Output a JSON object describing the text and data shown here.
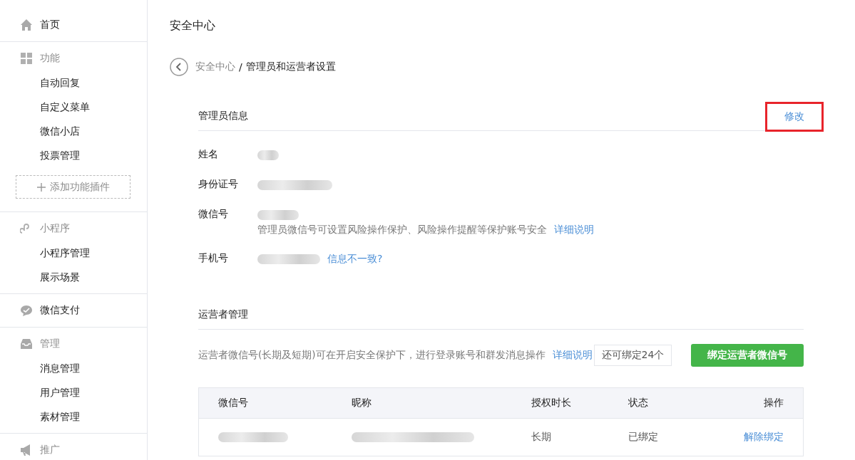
{
  "sidebar": {
    "sections": [
      {
        "kind": "link",
        "label": "首页"
      },
      {
        "kind": "group",
        "label": "功能",
        "items": [
          "自动回复",
          "自定义菜单",
          "微信小店",
          "投票管理"
        ],
        "add_button": "添加功能插件"
      },
      {
        "kind": "group",
        "label": "小程序",
        "items": [
          "小程序管理",
          "展示场景"
        ]
      },
      {
        "kind": "link",
        "label": "微信支付"
      },
      {
        "kind": "group",
        "label": "管理",
        "items": [
          "消息管理",
          "用户管理",
          "素材管理"
        ]
      },
      {
        "kind": "group",
        "label": "推广"
      }
    ]
  },
  "page": {
    "title": "安全中心",
    "breadcrumb": {
      "parent": "安全中心",
      "separator": "/",
      "current": "管理员和运营者设置"
    }
  },
  "admin": {
    "title": "管理员信息",
    "edit_link": "修改",
    "edit_highlighted": true,
    "fields": [
      {
        "label": "姓名"
      },
      {
        "label": "身份证号"
      },
      {
        "label": "微信号",
        "note": "管理员微信号可设置风险操作保护、风险操作提醒等保护账号安全",
        "note_link": "详细说明"
      },
      {
        "label": "手机号",
        "link": "信息不一致?"
      }
    ]
  },
  "operators": {
    "title": "运营者管理",
    "description": "运营者微信号(长期及短期)可在开启安全保护下，进行登录账号和群发消息操作",
    "description_link": "详细说明",
    "remaining": "还可绑定24个",
    "bind_button": "绑定运营者微信号",
    "table": {
      "columns": [
        "微信号",
        "昵称",
        "授权时长",
        "状态",
        "操作"
      ],
      "rows": [
        {
          "duration": "长期",
          "status": "已绑定",
          "action": "解除绑定"
        }
      ]
    }
  }
}
